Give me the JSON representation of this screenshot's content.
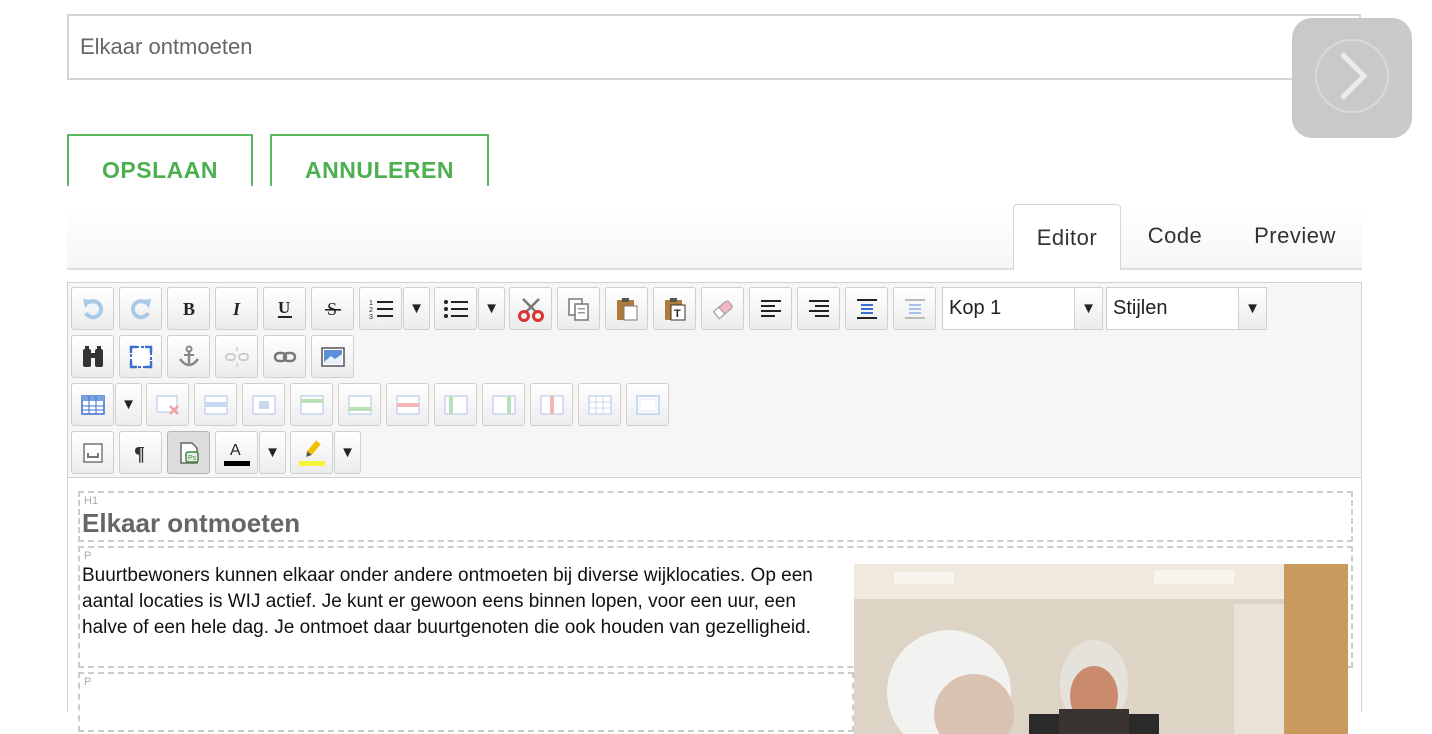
{
  "title_field": {
    "value": "Elkaar ontmoeten"
  },
  "actions": {
    "save": "OPSLAAN",
    "cancel": "ANNULEREN"
  },
  "tabs": [
    "Editor",
    "Code",
    "Preview"
  ],
  "toolbar": {
    "format_select": "Kop 1",
    "style_select": "Stijlen"
  },
  "content": {
    "h1_tag": "H1",
    "heading": "Elkaar ontmoeten",
    "p_tag": "P",
    "p2_tag": "P",
    "paragraph": "Buurtbewoners kunnen elkaar onder andere ontmoeten bij diverse wijklocaties. Op een aantal locaties is WIJ actief. Je kunt er gewoon eens binnen lopen, voor een uur, een halve of een hele dag. Je ontmoet daar buurtgenoten die ook houden van gezelligheid."
  },
  "colors": {
    "accent": "#5cb85c",
    "next_button": "#c7c7c7"
  }
}
